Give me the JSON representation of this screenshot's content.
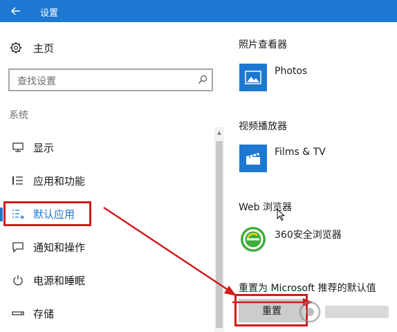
{
  "window": {
    "title": "设置"
  },
  "sidebar": {
    "home_label": "主页",
    "search_placeholder": "查找设置",
    "section_label": "系统",
    "items": [
      {
        "label": "显示",
        "icon": "monitor-icon"
      },
      {
        "label": "应用和功能",
        "icon": "list-icon"
      },
      {
        "label": "默认应用",
        "icon": "default-apps-icon",
        "active": true
      },
      {
        "label": "通知和操作",
        "icon": "notification-icon"
      },
      {
        "label": "电源和睡眠",
        "icon": "power-icon"
      },
      {
        "label": "存储",
        "icon": "storage-icon"
      }
    ]
  },
  "defaults": {
    "photo_viewer": {
      "category": "照片查看器",
      "app": "Photos",
      "icon": "photos-icon"
    },
    "video_player": {
      "category": "视频播放器",
      "app": "Films & TV",
      "icon": "films-tv-icon"
    },
    "web_browser": {
      "category": "Web 浏览器",
      "app": "360安全浏览器",
      "icon": "360-browser-icon"
    },
    "reset": {
      "label": "重置为 Microsoft 推荐的默认值",
      "button": "重置"
    }
  },
  "colors": {
    "accent": "#1e78d2",
    "annotation": "#d11a1a",
    "browser_green": "#3dae3a"
  }
}
